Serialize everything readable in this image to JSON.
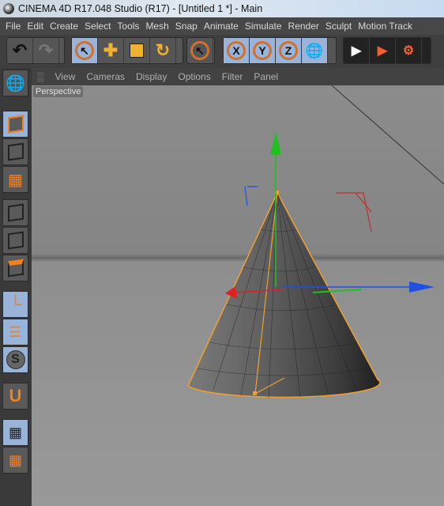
{
  "window": {
    "title": "CINEMA 4D R17.048 Studio (R17) - [Untitled 1 *] - Main"
  },
  "menu": [
    "File",
    "Edit",
    "Create",
    "Select",
    "Tools",
    "Mesh",
    "Snap",
    "Animate",
    "Simulate",
    "Render",
    "Sculpt",
    "Motion Track"
  ],
  "toolbar": {
    "undo": "undo-icon",
    "redo": "redo-icon",
    "axis_x": "X",
    "axis_y": "Y",
    "axis_z": "Z"
  },
  "viewport_menu": [
    "View",
    "Cameras",
    "Display",
    "Options",
    "Filter",
    "Panel"
  ],
  "viewport": {
    "label": "Perspective"
  },
  "colors": {
    "active": "#9ab3d8",
    "accent": "#f0a030",
    "x_axis": "#e02020",
    "y_axis": "#20c020",
    "z_axis": "#2050e0"
  }
}
